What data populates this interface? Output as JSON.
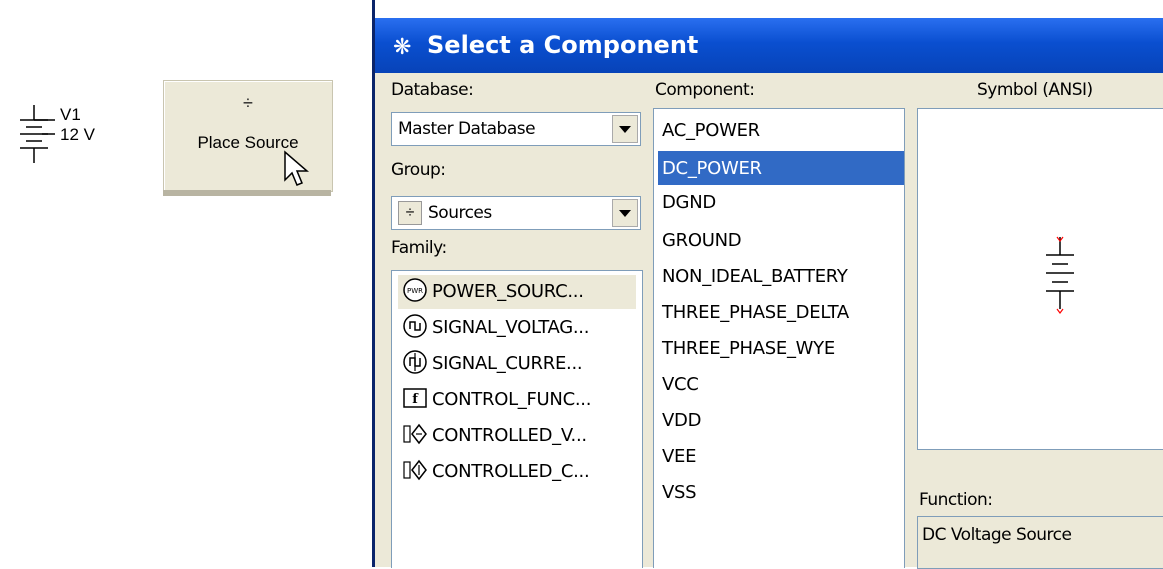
{
  "schematic": {
    "ref": "V1",
    "value": "12 V"
  },
  "place_source": {
    "label": "Place Source",
    "glyph": "÷"
  },
  "dialog": {
    "title": "Select a Component",
    "database_label": "Database:",
    "database_value": "Master Database",
    "group_label": "Group:",
    "group_value": "Sources",
    "family_label": "Family:",
    "families": [
      {
        "label": "POWER_SOURC...",
        "icon": "power-source-icon",
        "selected": true
      },
      {
        "label": "SIGNAL_VOLTAG...",
        "icon": "signal-voltage-icon",
        "selected": false
      },
      {
        "label": "SIGNAL_CURRE...",
        "icon": "signal-current-icon",
        "selected": false
      },
      {
        "label": "CONTROL_FUNC...",
        "icon": "control-function-icon",
        "selected": false
      },
      {
        "label": "CONTROLLED_V...",
        "icon": "controlled-voltage-icon",
        "selected": false
      },
      {
        "label": "CONTROLLED_C...",
        "icon": "controlled-current-icon",
        "selected": false
      }
    ],
    "component_label": "Component:",
    "components": [
      "AC_POWER",
      "DC_POWER",
      "DGND",
      "GROUND",
      "NON_IDEAL_BATTERY",
      "THREE_PHASE_DELTA",
      "THREE_PHASE_WYE",
      "VCC",
      "VDD",
      "VEE",
      "VSS"
    ],
    "selected_component": "DC_POWER",
    "symbol_label": "Symbol (ANSI)",
    "function_label": "Function:",
    "function_value": "DC Voltage Source"
  },
  "colors": {
    "titlebar": "#0a4fd0",
    "selection": "#316ac5",
    "dialog_bg": "#ece9d8"
  }
}
